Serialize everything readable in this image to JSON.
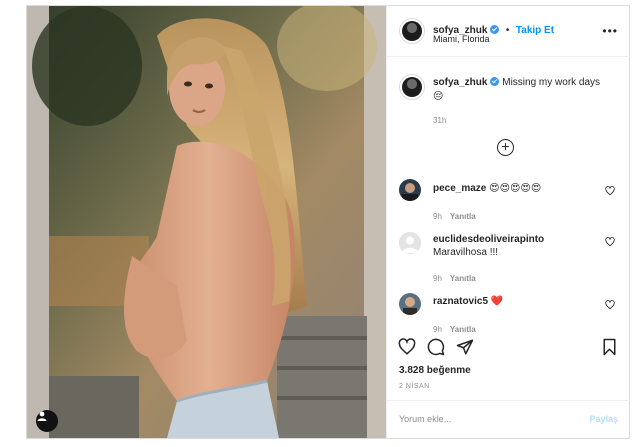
{
  "post": {
    "username": "sofya_zhuk",
    "follow_label": "Takip Et",
    "separator": "•",
    "location": "Miami, Florida",
    "more_label": "•••"
  },
  "caption": {
    "username": "sofya_zhuk",
    "text": "Missing my work days",
    "emoji": "😔",
    "time": "31h"
  },
  "comments": [
    {
      "username": "pece_maze",
      "text": "😍😍😍😍😍",
      "time": "9h",
      "reply_label": "Yanıtla"
    },
    {
      "username": "euclidesdeoliveirapinto",
      "text": "Maravilhosa !!!",
      "time": "9h",
      "reply_label": "Yanıtla"
    },
    {
      "username": "raznatovic5",
      "text": "❤️",
      "time": "9h",
      "reply_label": "Yanıtla"
    }
  ],
  "stats": {
    "likes": "3.828 beğenme",
    "date": "2 NİSAN"
  },
  "composer": {
    "placeholder": "Yorum ekle...",
    "post_label": "Paylaş"
  },
  "colors": {
    "accent": "#0095f6",
    "verified": "#3897f0",
    "heart_red": "#ed4956",
    "muted": "#8e8e8e",
    "post_disabled": "#b2dffc"
  },
  "icons": [
    "verified-badge-icon",
    "more-options-icon",
    "add-comments-icon",
    "heart-icon",
    "comment-icon",
    "share-icon",
    "save-icon",
    "user-tag-icon"
  ]
}
